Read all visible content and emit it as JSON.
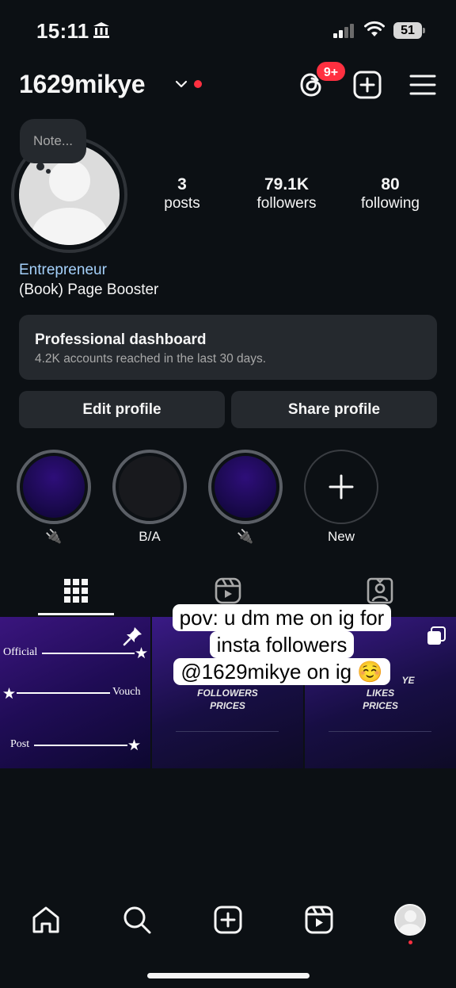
{
  "status_bar": {
    "time": "15:11",
    "battery": "51"
  },
  "header": {
    "username": "1629mikye",
    "notification_count": "9+"
  },
  "profile": {
    "note_placeholder": "Note...",
    "stats": [
      {
        "value": "3",
        "label": "posts"
      },
      {
        "value": "79.1K",
        "label": "followers"
      },
      {
        "value": "80",
        "label": "following"
      }
    ],
    "category": "Entrepreneur",
    "bio": "(Book) Page Booster"
  },
  "dashboard": {
    "title": "Professional dashboard",
    "subtitle": "4.2K accounts reached in the last 30 days."
  },
  "buttons": {
    "edit": "Edit profile",
    "share": "Share profile"
  },
  "highlights": [
    {
      "label": "🔌",
      "style": "purple"
    },
    {
      "label": "B/A",
      "style": "dark"
    },
    {
      "label": "🔌",
      "style": "purple"
    },
    {
      "label": "New",
      "style": "new"
    }
  ],
  "tabs": [
    "grid-icon",
    "reels-icon",
    "tagged-icon"
  ],
  "posts": {
    "tile1": {
      "top": "Official",
      "middle": "Vouch",
      "bottom": "Post"
    },
    "tile2": {
      "caption_line1": "FOLLOWERS",
      "caption_line2": "PRICES"
    },
    "tile3": {
      "caption_line0": "YE",
      "caption_line1": "LIKES",
      "caption_line2": "PRICES"
    }
  },
  "overlay_text": {
    "line1": "pov: u dm me on ig for",
    "line2": "insta followers",
    "line3": "@1629mikye on ig ☺️"
  },
  "colors": {
    "background": "#0c1014",
    "accent_red": "#ff3040",
    "card": "#25292e",
    "link_blue": "#a5d1fb"
  }
}
